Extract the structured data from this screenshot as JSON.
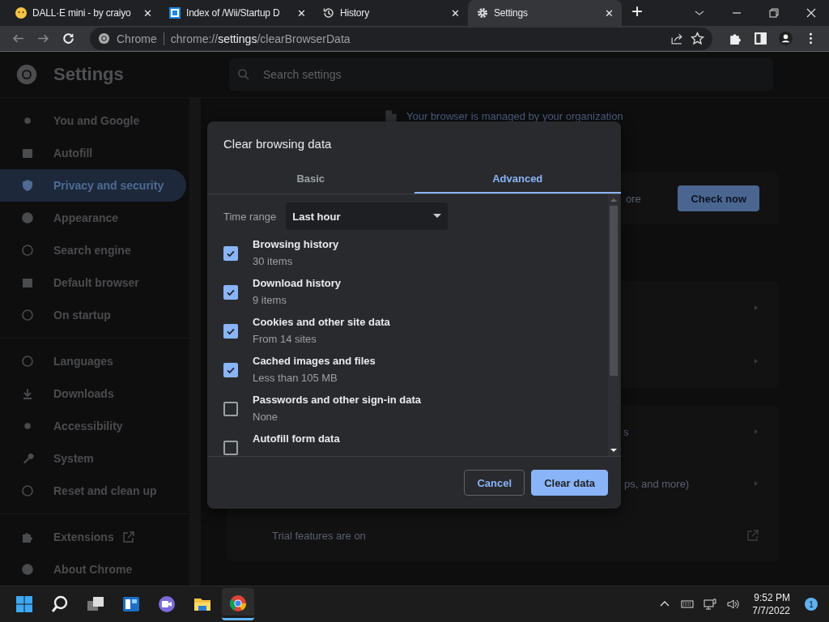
{
  "tabs": [
    {
      "title": "DALL·E mini - by craiyo",
      "selected": false,
      "close": "✕"
    },
    {
      "title": "Index of /Wii/Startup D",
      "selected": false,
      "close": "✕"
    },
    {
      "title": "History",
      "selected": false,
      "close": "✕"
    },
    {
      "title": "Settings",
      "selected": true,
      "close": "✕"
    }
  ],
  "new_tab": "+",
  "address_bar": {
    "site": "Chrome",
    "scheme": "chrome://",
    "host": "settings",
    "path": "/clearBrowserData"
  },
  "settings_header": {
    "title": "Settings",
    "search_placeholder": "Search settings"
  },
  "sidebar": {
    "groups": [
      [
        {
          "label": "You and Google",
          "selected": false
        },
        {
          "label": "Autofill",
          "selected": false
        },
        {
          "label": "Privacy and security",
          "selected": true
        },
        {
          "label": "Appearance",
          "selected": false
        },
        {
          "label": "Search engine",
          "selected": false
        },
        {
          "label": "Default browser",
          "selected": false
        },
        {
          "label": "On startup",
          "selected": false
        }
      ],
      [
        {
          "label": "Languages",
          "selected": false
        },
        {
          "label": "Downloads",
          "selected": false
        },
        {
          "label": "Accessibility",
          "selected": false
        },
        {
          "label": "System",
          "selected": false
        },
        {
          "label": "Reset and clean up",
          "selected": false
        }
      ],
      [
        {
          "label": "Extensions",
          "selected": false,
          "external": true
        },
        {
          "label": "About Chrome",
          "selected": false,
          "external": false
        }
      ]
    ]
  },
  "background": {
    "managed_notice": "Your browser is managed by your organization",
    "safety_fragment": "ore",
    "check_button": "Check now",
    "row_fragment_1": "s",
    "row_fragment_2": "ps, and more)",
    "trial_note": "Trial features are on"
  },
  "dialog": {
    "title": "Clear browsing data",
    "tabs": [
      {
        "label": "Basic",
        "selected": false
      },
      {
        "label": "Advanced",
        "selected": true
      }
    ],
    "time_range": {
      "label": "Time range",
      "value": "Last hour"
    },
    "items": [
      {
        "name": "Browsing history",
        "detail": "30 items",
        "checked": true
      },
      {
        "name": "Download history",
        "detail": "9 items",
        "checked": true
      },
      {
        "name": "Cookies and other site data",
        "detail": "From 14 sites",
        "checked": true
      },
      {
        "name": "Cached images and files",
        "detail": "Less than 105 MB",
        "checked": true
      },
      {
        "name": "Passwords and other sign-in data",
        "detail": "None",
        "checked": false
      },
      {
        "name": "Autofill form data",
        "checked": false
      }
    ],
    "buttons": [
      {
        "label": "Cancel",
        "kind": "secondary"
      },
      {
        "label": "Clear data",
        "kind": "primary"
      }
    ]
  },
  "taskbar": {
    "apps": [
      {
        "selected": false
      },
      {
        "selected": false
      },
      {
        "selected": false
      },
      {
        "selected": false
      },
      {
        "selected": false
      },
      {
        "selected": false
      },
      {
        "selected": true
      }
    ],
    "time": "9:52 PM",
    "date": "7/7/2022",
    "notifications": "1"
  }
}
